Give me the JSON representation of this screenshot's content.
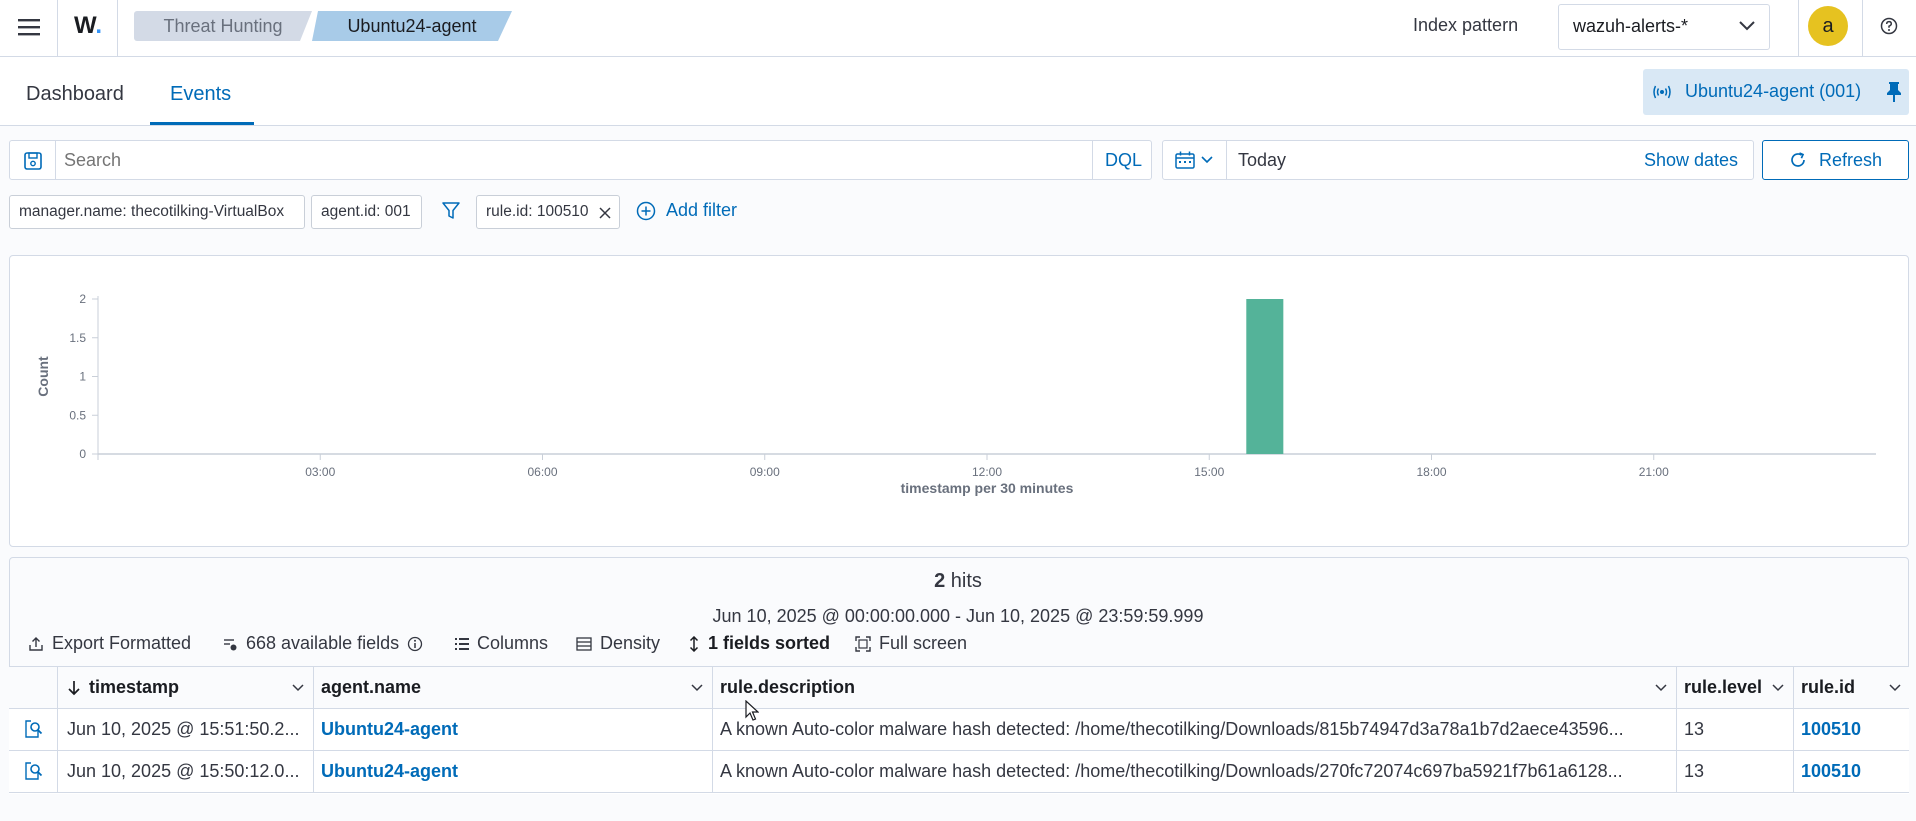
{
  "header": {
    "logo_text": "W.",
    "breadcrumbs": [
      "Threat Hunting",
      "Ubuntu24-agent"
    ],
    "index_pattern_label": "Index pattern",
    "index_pattern_value": "wazuh-alerts-*",
    "avatar_letter": "a",
    "menu_icon": "hamburger-icon",
    "help_icon": "help-icon"
  },
  "tabs": [
    {
      "label": "Dashboard"
    },
    {
      "label": "Events"
    }
  ],
  "agent_badge": "Ubuntu24-agent (001)",
  "query": {
    "search_placeholder": "Search",
    "language": "DQL",
    "date_value": "Today",
    "show_dates": "Show dates",
    "refresh": "Refresh"
  },
  "filters": [
    {
      "label": "manager.name: thecotilking-VirtualBox"
    },
    {
      "label": "agent.id: 001"
    },
    {
      "label": "rule.id: 100510"
    }
  ],
  "add_filter": "Add filter",
  "chart_data": {
    "type": "bar",
    "ylabel": "Count",
    "xlabel": "timestamp per 30 minutes",
    "ylim": [
      0,
      2
    ],
    "y_ticks": [
      "2",
      "1.5",
      "1",
      "0.5",
      "0"
    ],
    "x_ticks": [
      "03:00",
      "06:00",
      "09:00",
      "12:00",
      "15:00",
      "18:00",
      "21:00"
    ],
    "x_range_hours": [
      0,
      24
    ],
    "bars": [
      {
        "x": "15:30",
        "start_hour": 15.5,
        "value": 2
      }
    ],
    "color": "#54b399",
    "grid": false
  },
  "results": {
    "hits_count": "2",
    "hits_label": "hits",
    "time_range": "Jun 10, 2025 @ 00:00:00.000 - Jun 10, 2025 @ 23:59:59.999",
    "toolbar": {
      "export": "Export Formatted",
      "fields": "668 available fields",
      "columns": "Columns",
      "density": "Density",
      "sorted": "1 fields sorted",
      "fullscreen": "Full screen"
    },
    "columns": [
      "timestamp",
      "agent.name",
      "rule.description",
      "rule.level",
      "rule.id"
    ],
    "rows": [
      {
        "timestamp": "Jun 10, 2025 @ 15:51:50.2...",
        "agent": "Ubuntu24-agent",
        "description": "A known Auto-color malware hash detected: /home/thecotilking/Downloads/815b74947d3a78a1b7d2aece43596...",
        "level": "13",
        "rule_id": "100510"
      },
      {
        "timestamp": "Jun 10, 2025 @ 15:50:12.0...",
        "agent": "Ubuntu24-agent",
        "description": "A known Auto-color malware hash detected: /home/thecotilking/Downloads/270fc72074c697ba5921f7b61a6128...",
        "level": "13",
        "rule_id": "100510"
      }
    ]
  },
  "colors": {
    "accent": "#006bb8",
    "bar": "#54b399",
    "crumb_active": "#a8cbe8",
    "avatar": "#e6c220"
  }
}
